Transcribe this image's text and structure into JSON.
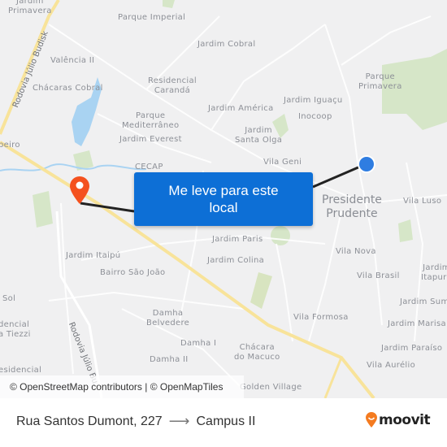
{
  "map": {
    "neighborhoods": [
      {
        "name": "Jardim Primavera",
        "lines": [
          "Jardim",
          "Primavera"
        ]
      },
      {
        "name": "Parque Imperial",
        "lines": [
          "Parque Imperial"
        ]
      },
      {
        "name": "Jardim Cobral",
        "lines": [
          "Jardim Cobral"
        ]
      },
      {
        "name": "Valência II",
        "lines": [
          "Valência II"
        ]
      },
      {
        "name": "Chácaras Cobral",
        "lines": [
          "Chácaras Cobral"
        ]
      },
      {
        "name": "Residencial Carandá",
        "lines": [
          "Residencial",
          "Carandá"
        ]
      },
      {
        "name": "Parque Primavera",
        "lines": [
          "Parque",
          "Primavera"
        ]
      },
      {
        "name": "Jardim Iguaçu",
        "lines": [
          "Jardim Iguaçu"
        ]
      },
      {
        "name": "Jardim América",
        "lines": [
          "Jardim América"
        ]
      },
      {
        "name": "Inocoop",
        "lines": [
          "Inocoop"
        ]
      },
      {
        "name": "Parque Mediterrâneo",
        "lines": [
          "Parque",
          "Mediterrâneo"
        ]
      },
      {
        "name": "Jardim Everest",
        "lines": [
          "Jardim Everest"
        ]
      },
      {
        "name": "Jardim Santa Olga",
        "lines": [
          "Jardim",
          "Santa Olga"
        ]
      },
      {
        "name": "Vila Geni",
        "lines": [
          "Vila Geni"
        ]
      },
      {
        "name": "CECAP",
        "lines": [
          "CECAP"
        ]
      },
      {
        "name": "Vila Luso",
        "lines": [
          "Vila Luso"
        ]
      },
      {
        "name": "Jardim Paris",
        "lines": [
          "Jardim Paris"
        ]
      },
      {
        "name": "Jardim Colina",
        "lines": [
          "Jardim Colina"
        ]
      },
      {
        "name": "Vila Nova",
        "lines": [
          "Vila Nova"
        ]
      },
      {
        "name": "Vila Brasil",
        "lines": [
          "Vila Brasil"
        ]
      },
      {
        "name": "Jardim Itapura",
        "lines": [
          "Jardim",
          "Itapura"
        ]
      },
      {
        "name": "Jardim Itaipú",
        "lines": [
          "Jardim Itaipú"
        ]
      },
      {
        "name": "Bairro São João",
        "lines": [
          "Bairro São João"
        ]
      },
      {
        "name": "Sol",
        "lines": [
          "Sol"
        ]
      },
      {
        "name": "Residencial Tiezzi",
        "lines": [
          "dencial",
          "a Tiezzi"
        ]
      },
      {
        "name": "Residencial Monte Carlo",
        "lines": [
          "esidencial"
        ]
      },
      {
        "name": "Damha Belvedere",
        "lines": [
          "Damha",
          "Belvedere"
        ]
      },
      {
        "name": "Damha I",
        "lines": [
          "Damha I"
        ]
      },
      {
        "name": "Damha II",
        "lines": [
          "Damha II"
        ]
      },
      {
        "name": "Chácara do Macuco",
        "lines": [
          "Chácara",
          "do Macuco"
        ]
      },
      {
        "name": "Vila Formosa",
        "lines": [
          "Vila Formosa"
        ]
      },
      {
        "name": "Jardim Sumaré",
        "lines": [
          "Jardim Sum"
        ]
      },
      {
        "name": "Jardim Marisa",
        "lines": [
          "Jardim Marisa"
        ]
      },
      {
        "name": "Jardim Paraíso",
        "lines": [
          "Jardim Paraíso"
        ]
      },
      {
        "name": "Vila Aurélio",
        "lines": [
          "Vila Aurélio"
        ]
      },
      {
        "name": "Golden Village",
        "lines": [
          "Golden Village"
        ]
      },
      {
        "name": "Ribeiro",
        "lines": [
          "beiro"
        ]
      }
    ],
    "city_label": [
      "Presidente",
      "Prudente"
    ],
    "road_labels": {
      "north": "Rodovia Júlio Budisk",
      "south": "Rodovia Júlio Bu"
    },
    "cta_button": "Me leve para este local",
    "attribution": "© OpenStreetMap contributors | © OpenMapTiles",
    "colors": {
      "origin_marker": "#2f7de1",
      "destination_marker": "#f4511e",
      "cta_background": "#0d6fd6",
      "highway": "#f8e39a",
      "water": "#a9d3f2",
      "park": "#cfe3bf"
    }
  },
  "footer": {
    "origin": "Rua Santos Dumont, 227",
    "arrow": "⟶",
    "destination": "Campus II",
    "brand": "moovit"
  }
}
